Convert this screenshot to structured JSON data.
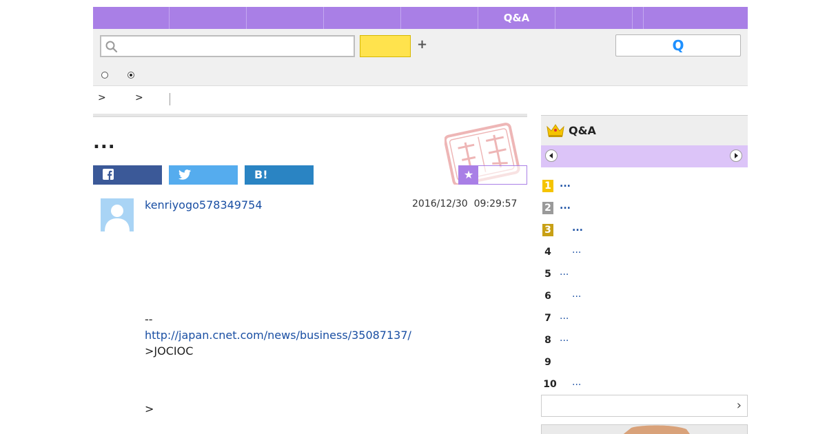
{
  "nav": {
    "items": [
      {
        "label": ""
      },
      {
        "label": ""
      },
      {
        "label": ""
      },
      {
        "label": ""
      },
      {
        "label": ""
      },
      {
        "label": "Q&A"
      },
      {
        "label": ""
      },
      {
        "label": ""
      },
      {
        "label": ""
      }
    ]
  },
  "search": {
    "placeholder": "",
    "value": ""
  },
  "toolbar": {
    "question_icon": "Q"
  },
  "breadcrumb": {
    "sep1": ">",
    "sep2": ">"
  },
  "question": {
    "title": "..."
  },
  "share": {
    "hatena_label": "B!"
  },
  "bookmark": {
    "star": "★"
  },
  "post": {
    "username": "kenriyogo578349754",
    "date": "2016/12/30  09:29:57",
    "line1": "--",
    "link": "http://japan.cnet.com/news/business/35087137/",
    "line3": ">JOCIOC",
    "line4": ">"
  },
  "ranking": {
    "title": "Q&A",
    "items": [
      {
        "rank": "1",
        "title": "..."
      },
      {
        "rank": "2",
        "title": "..."
      },
      {
        "rank": "3",
        "title": "..."
      },
      {
        "rank": "4",
        "title": "..."
      },
      {
        "rank": "5",
        "title": "..."
      },
      {
        "rank": "6",
        "title": "..."
      },
      {
        "rank": "7",
        "title": "..."
      },
      {
        "rank": "8",
        "title": "..."
      },
      {
        "rank": "9",
        "title": ""
      },
      {
        "rank": "10",
        "title": "..."
      }
    ],
    "more_arrow": "›"
  },
  "colors": {
    "nav_purple": "#a97fe6",
    "pager_lavender": "#dcc4f8",
    "search_yellow": "#ffe34d",
    "link_blue": "#1a4fa3",
    "facebook": "#3b5998",
    "twitter": "#55acee",
    "hatena": "#2a84c3"
  }
}
